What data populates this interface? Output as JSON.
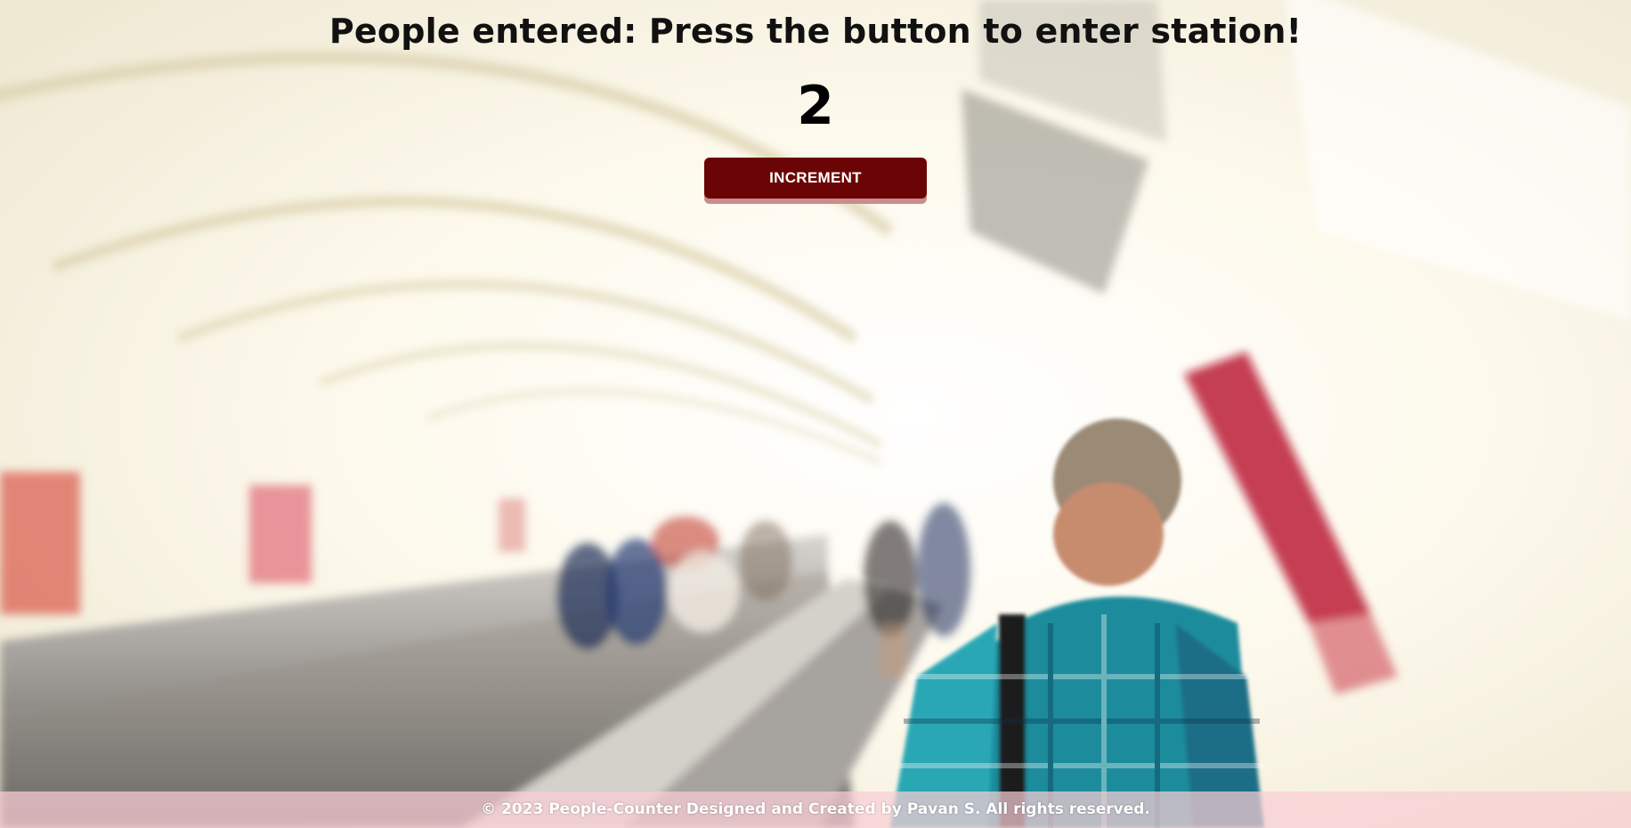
{
  "page": {
    "heading": "People entered: Press the button to enter station!",
    "counter_value": "2",
    "increment_button_label": "INCREMENT",
    "footer_text": "© 2023 People-Counter Designed and Created by Pavan S. All rights reserved."
  },
  "background": {
    "description_icon": "subway-escalator-photo-background"
  },
  "colors": {
    "button": "#6b0505",
    "button_shadow": "#c98d8d",
    "footer_bg": "#f8cdd4",
    "text": "#111111"
  }
}
